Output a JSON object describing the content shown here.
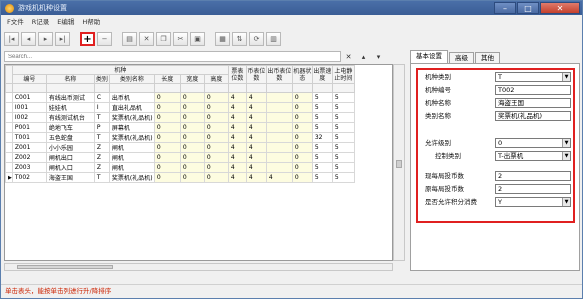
{
  "window": {
    "title": "游戏机机种设置"
  },
  "menu": [
    "F文件",
    "R记录",
    "E编辑",
    "H帮助"
  ],
  "toolbar": {
    "add_label": "+",
    "remove_label": "−"
  },
  "search": {
    "placeholder": "Search..."
  },
  "grid": {
    "group_header": "机种",
    "columns": [
      "编号",
      "名称",
      "类别",
      "类别名称",
      "长度",
      "宽度",
      "高度",
      "票表位数",
      "币表位数",
      "出币表位数",
      "机器状态",
      "出票速度",
      "上电静止时间"
    ],
    "rows": [
      [
        "C001",
        "有线出币测试",
        "C",
        "出币机",
        "0",
        "0",
        "0",
        "4",
        "4",
        "",
        "0",
        "5",
        "5"
      ],
      [
        "I001",
        "娃娃机",
        "I",
        "直出礼品机",
        "0",
        "0",
        "0",
        "4",
        "4",
        "",
        "0",
        "5",
        "5"
      ],
      [
        "I002",
        "有线测试机台",
        "T",
        "奖票机(礼品机)",
        "0",
        "0",
        "0",
        "4",
        "4",
        "",
        "0",
        "5",
        "5"
      ],
      [
        "P001",
        "绝地飞车",
        "P",
        "屏幕机",
        "0",
        "0",
        "0",
        "4",
        "4",
        "",
        "0",
        "5",
        "5"
      ],
      [
        "T001",
        "五色蛇盘",
        "T",
        "奖票机(礼品机)",
        "0",
        "0",
        "0",
        "4",
        "4",
        "",
        "0",
        "32",
        "5"
      ],
      [
        "Z001",
        "小小乐园",
        "Z",
        "闸机",
        "0",
        "0",
        "0",
        "4",
        "4",
        "",
        "0",
        "5",
        "5"
      ],
      [
        "Z002",
        "闸机出口",
        "Z",
        "闸机",
        "0",
        "0",
        "0",
        "4",
        "4",
        "",
        "0",
        "5",
        "5"
      ],
      [
        "Z003",
        "闸机入口",
        "Z",
        "闸机",
        "0",
        "0",
        "0",
        "4",
        "4",
        "",
        "0",
        "5",
        "5"
      ],
      [
        "T002",
        "海盗王国",
        "T",
        "奖票机(礼品机)",
        "0",
        "0",
        "0",
        "4",
        "4",
        "4",
        "0",
        "5",
        "5"
      ]
    ]
  },
  "status": {
    "text": "单击表头，能按单击列进行升/降排序"
  },
  "tabs": [
    "基本设置",
    "高级",
    "其他"
  ],
  "props": [
    {
      "label": "机种类别",
      "value": "T",
      "dropdown": true
    },
    {
      "label": "机种编号",
      "value": "T002",
      "dropdown": false
    },
    {
      "label": "机种名称",
      "value": "海盗王国",
      "dropdown": false
    },
    {
      "label": "类别名称",
      "value": "奖票机(礼品机)",
      "dropdown": false
    },
    {
      "label": "允许级别",
      "value": "0",
      "dropdown": true
    },
    {
      "label": "控制类别",
      "value": "T-出票机",
      "dropdown": true
    },
    {
      "label": "现每局投币数",
      "value": "2",
      "dropdown": false
    },
    {
      "label": "原每局投币数",
      "value": "2",
      "dropdown": false
    },
    {
      "label": "是否允许积分消费",
      "value": "Y",
      "dropdown": true
    }
  ]
}
